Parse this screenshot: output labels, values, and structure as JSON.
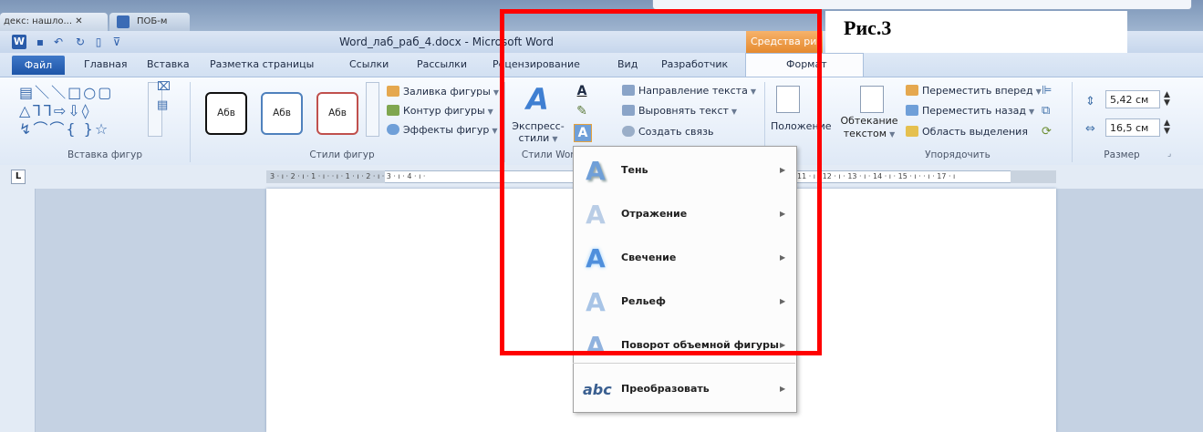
{
  "browser": {
    "tab1_text": "декс: нашло...",
    "tab2_text": "ПОБ-м"
  },
  "titlebar": {
    "app_icon": "W",
    "doc_title": "Word_лаб_раб_4.docx - Microsoft Word",
    "context_tools": "Средства ри"
  },
  "ribbon_tabs": [
    "Файл",
    "Главная",
    "Вставка",
    "Разметка страницы",
    "Ссылки",
    "Рассылки",
    "Рецензирование",
    "Вид",
    "Разработчик",
    "Формат"
  ],
  "groups": {
    "insert_shapes": "Вставка фигур",
    "shape_styles": "Стили фигур",
    "wordart_styles": "Стили Word",
    "arrange": "Упорядочить",
    "size": "Размер"
  },
  "shape_styles": {
    "sample_text": "Абв",
    "fill": "Заливка фигуры",
    "outline": "Контур фигуры",
    "effects": "Эффекты фигур"
  },
  "wordart": {
    "express_line1": "Экспресс-",
    "express_line2": "стили"
  },
  "text_group": {
    "direction": "Направление текста",
    "align": "Выровнять текст",
    "link": "Создать связь"
  },
  "arrange": {
    "position": "Положение",
    "wrap_line1": "Обтекание",
    "wrap_line2": "текстом",
    "bring_forward": "Переместить вперед",
    "send_backward": "Переместить назад",
    "selection_pane": "Область выделения"
  },
  "size": {
    "height": "5,42 см",
    "width": "16,5 см"
  },
  "ruler_text": "3 · ı · 2 · ı · 1 · ı ·   · ı · 1 · ı · 2 · ı · 3 · ı · 4 · ı ·",
  "ruler_text_right": "11 · ı · 12 · ı · 13 · ı · 14 · ı · 15 · ı ·   · ı · 17 · ı",
  "menu_items": [
    {
      "label": "Тень",
      "icon": "text-shadow-icon"
    },
    {
      "label": "Отражение",
      "icon": "text-reflection-icon"
    },
    {
      "label": "Свечение",
      "icon": "text-glow-icon"
    },
    {
      "label": "Рельеф",
      "icon": "text-bevel-icon"
    },
    {
      "label": "Поворот объемной фигуры",
      "icon": "3d-rotation-icon"
    },
    {
      "label": "Преобразовать",
      "icon": "transform-icon"
    }
  ],
  "annotation": {
    "label": "Рис.3"
  },
  "colors": {
    "annotation_border": "#ff0000",
    "tools_tab": "#e58a2e",
    "file_tab": "#2a62b5"
  }
}
